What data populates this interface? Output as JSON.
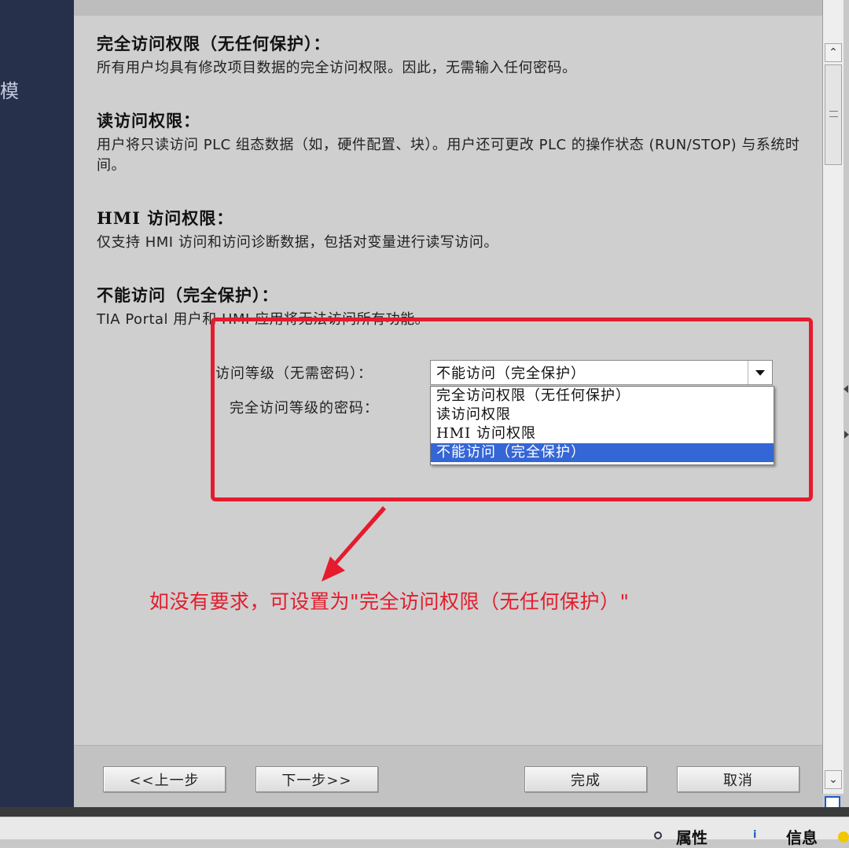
{
  "nav": {
    "label": "模"
  },
  "sections": [
    {
      "title": "完全访问权限（无任何保护）：",
      "text": "所有用户均具有修改项目数据的完全访问权限。因此，无需输入任何密码。"
    },
    {
      "title": "读访问权限：",
      "text": "用户将只读访问 PLC 组态数据（如，硬件配置、块）。用户还可更改 PLC 的操作状态 (RUN/STOP) 与系统时间。"
    },
    {
      "title": "HMI 访问权限：",
      "text": "仅支持 HMI 访问和访问诊断数据，包括对变量进行读写访问。"
    },
    {
      "title": "不能访问（完全保护）：",
      "text": "TIA Portal 用户和 HMI 应用将无法访问所有功能。"
    }
  ],
  "form": {
    "level_label": "访问等级（无需密码）：",
    "password_label": "完全访问等级的密码：",
    "selected_value": "不能访问（完全保护）",
    "options": [
      "完全访问权限（无任何保护）",
      "读访问权限",
      "HMI 访问权限",
      "不能访问（完全保护）"
    ],
    "highlighted_option_index": 3
  },
  "annotation": {
    "text": "如没有要求，可设置为\"完全访问权限（无任何保护）\"",
    "color": "#e31c2c"
  },
  "buttons": {
    "prev": "<<上一步",
    "next": "下一步>>",
    "finish": "完成",
    "cancel": "取消"
  },
  "status_tabs": {
    "properties": "属性",
    "info": "信息"
  },
  "colors": {
    "nav_bg": "#27304b",
    "selection": "#3566d6",
    "highlight_border": "#e51b2e"
  }
}
